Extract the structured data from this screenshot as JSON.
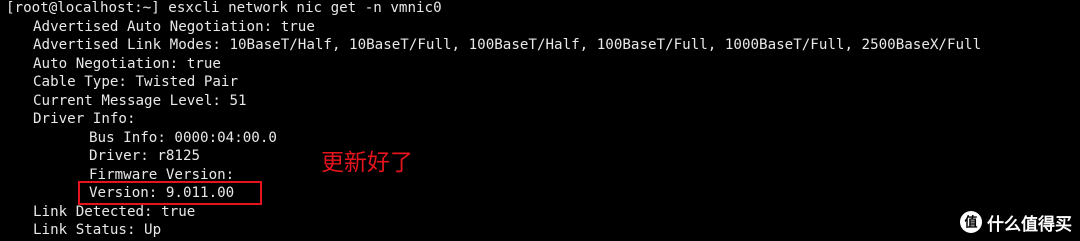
{
  "terminal": {
    "prompt_line": "[root@localhost:~] esxcli network nic get -n vmnic0",
    "lines": [
      "Advertised Auto Negotiation: true",
      "Advertised Link Modes: 10BaseT/Half, 10BaseT/Full, 100BaseT/Half, 100BaseT/Full, 1000BaseT/Full, 2500BaseX/Full",
      "Auto Negotiation: true",
      "Cable Type: Twisted Pair",
      "Current Message Level: 51",
      "Driver Info:",
      "Bus Info: 0000:04:00.0",
      "Driver: r8125",
      "Firmware Version:",
      "Version: 9.011.00",
      "Link Detected: true",
      "Link Status: Up"
    ]
  },
  "annotation": {
    "text": "更新好了",
    "color": "#e5141c"
  },
  "watermark": {
    "icon": "smzdm-logo-icon",
    "text": "什么值得买"
  },
  "colors": {
    "background": "#000000",
    "foreground": "#e8e8e8",
    "highlight": "#e5141c"
  }
}
